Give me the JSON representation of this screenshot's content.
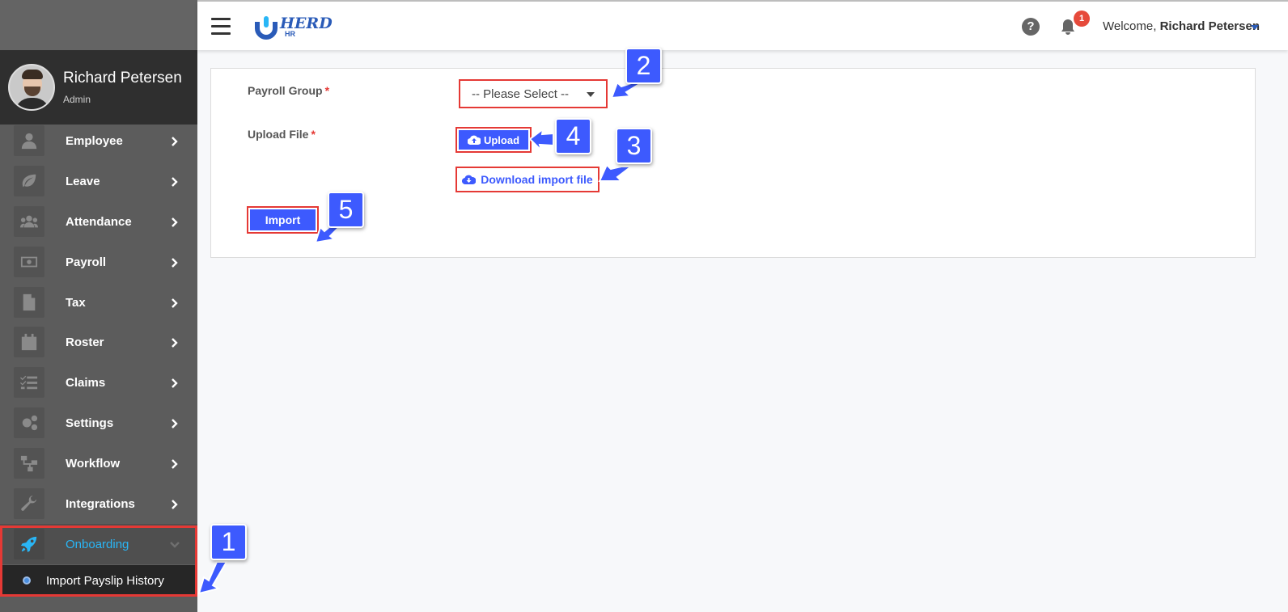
{
  "user": {
    "name": "Richard Petersen",
    "role": "Admin"
  },
  "header": {
    "brand": "HERD",
    "brand_sub": "HR",
    "welcome_prefix": "Welcome,",
    "welcome_name": "Richard Petersen",
    "notification_count": "1"
  },
  "sidebar": {
    "items": [
      {
        "label": "Employee",
        "icon": "user-icon"
      },
      {
        "label": "Leave",
        "icon": "leaf-icon"
      },
      {
        "label": "Attendance",
        "icon": "users-icon"
      },
      {
        "label": "Payroll",
        "icon": "money-icon"
      },
      {
        "label": "Tax",
        "icon": "file-icon"
      },
      {
        "label": "Roster",
        "icon": "calendar-icon"
      },
      {
        "label": "Claims",
        "icon": "checklist-icon"
      },
      {
        "label": "Settings",
        "icon": "gears-icon"
      },
      {
        "label": "Workflow",
        "icon": "sitemap-icon"
      },
      {
        "label": "Integrations",
        "icon": "wrench-icon"
      },
      {
        "label": "Onboarding",
        "icon": "rocket-icon"
      }
    ],
    "subitem": "Import Payslip History",
    "active_color": "#29b6f6"
  },
  "form": {
    "payroll_group_label": "Payroll Group",
    "payroll_group_value": "-- Please Select --",
    "upload_file_label": "Upload File",
    "required_mark": "*",
    "upload_button": "Upload",
    "download_button": "Download import file",
    "import_button": "Import"
  },
  "annotations": [
    "1",
    "2",
    "3",
    "4",
    "5"
  ],
  "colors": {
    "accent": "#3d5afe",
    "highlight": "#e53935",
    "sidebar": "#5c5c5c"
  }
}
